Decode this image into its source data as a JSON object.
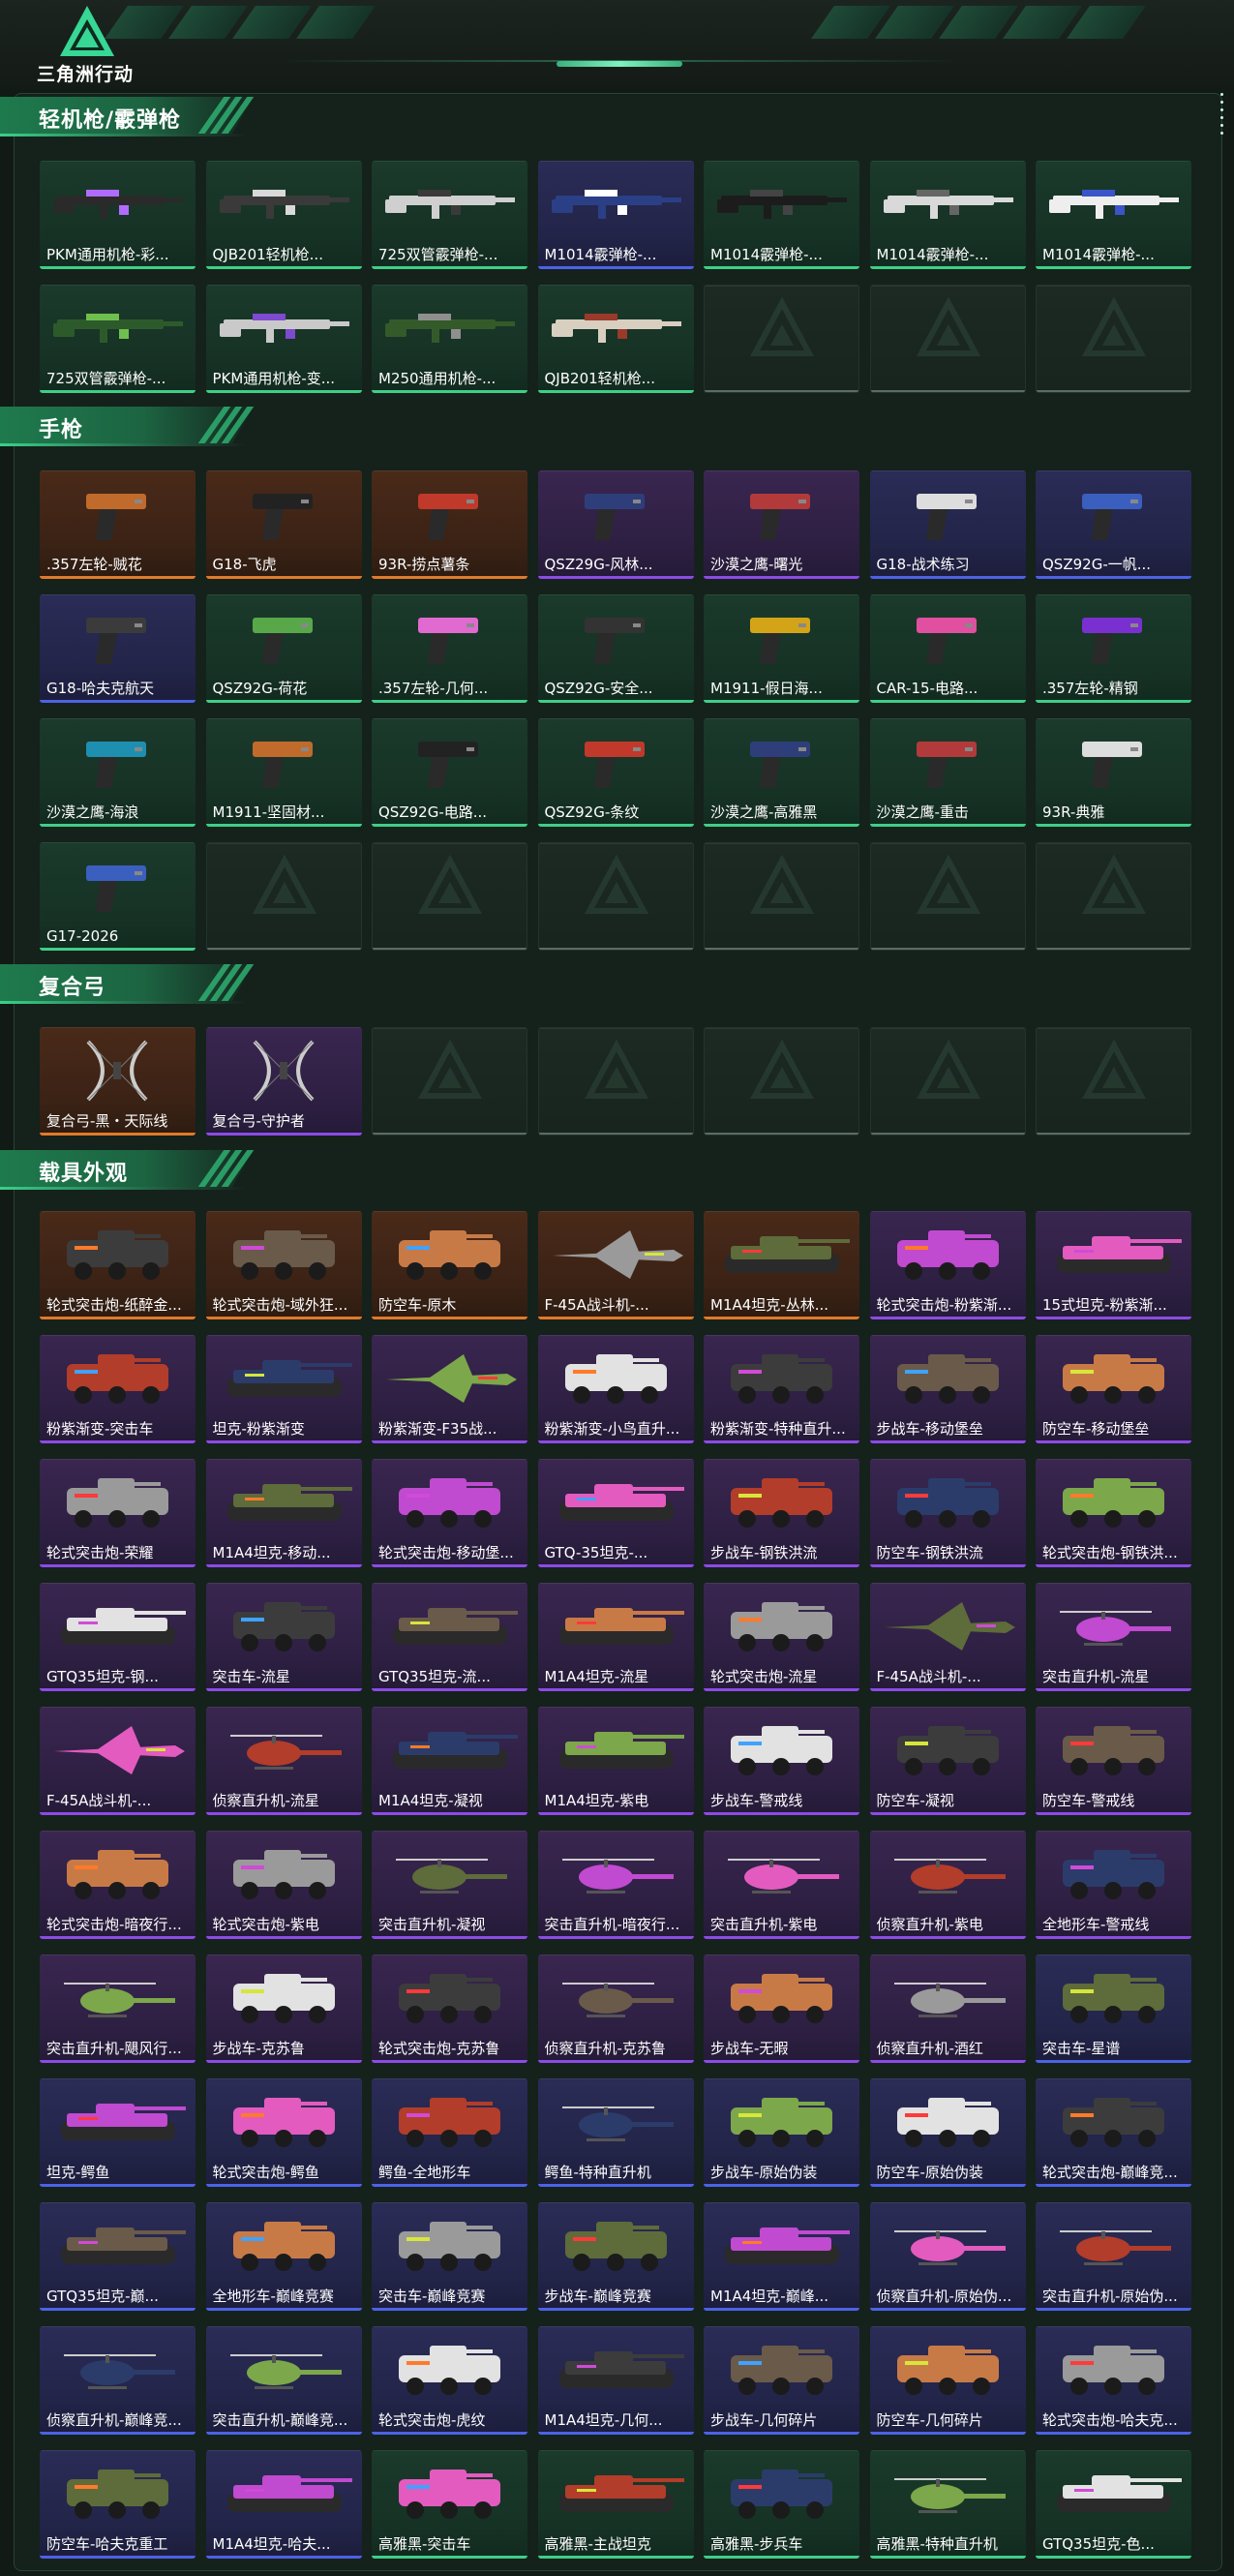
{
  "app": {
    "logo_text": "三角洲行动"
  },
  "sections": [
    {
      "id": "lmg-shotgun",
      "title": "轻机枪/霰弹枪",
      "kind": "gun",
      "items": [
        {
          "label": "PKM通用机枪-彩...",
          "rarity": "green"
        },
        {
          "label": "QJB201轻机枪...",
          "rarity": "green"
        },
        {
          "label": "725双管霰弹枪-...",
          "rarity": "green"
        },
        {
          "label": "M1014霰弹枪-...",
          "rarity": "blue"
        },
        {
          "label": "M1014霰弹枪-...",
          "rarity": "green"
        },
        {
          "label": "M1014霰弹枪-...",
          "rarity": "green"
        },
        {
          "label": "M1014霰弹枪-...",
          "rarity": "green"
        },
        {
          "label": "725双管霰弹枪-...",
          "rarity": "green"
        },
        {
          "label": "PKM通用机枪-变...",
          "rarity": "green"
        },
        {
          "label": "M250通用机枪-...",
          "rarity": "green"
        },
        {
          "label": "QJB201轻机枪...",
          "rarity": "green"
        },
        {
          "label": "",
          "rarity": "empty"
        },
        {
          "label": "",
          "rarity": "empty"
        },
        {
          "label": "",
          "rarity": "empty"
        }
      ]
    },
    {
      "id": "pistol",
      "title": "手枪",
      "kind": "pistol",
      "items": [
        {
          "label": ".357左轮-贼花",
          "rarity": "orange"
        },
        {
          "label": "G18-飞虎",
          "rarity": "orange"
        },
        {
          "label": "93R-捞点薯条",
          "rarity": "orange"
        },
        {
          "label": "QSZ29G-风林...",
          "rarity": "purple"
        },
        {
          "label": "沙漠之鹰-曙光",
          "rarity": "purple"
        },
        {
          "label": "G18-战术练习",
          "rarity": "blue"
        },
        {
          "label": "QSZ92G-一帆...",
          "rarity": "blue"
        },
        {
          "label": "G18-哈夫克航天",
          "rarity": "blue"
        },
        {
          "label": "QSZ92G-荷花",
          "rarity": "green"
        },
        {
          "label": ".357左轮-几何...",
          "rarity": "green"
        },
        {
          "label": "QSZ92G-安全...",
          "rarity": "green"
        },
        {
          "label": "M1911-假日海...",
          "rarity": "green"
        },
        {
          "label": "CAR-15-电路...",
          "rarity": "green"
        },
        {
          "label": ".357左轮-精钢",
          "rarity": "green"
        },
        {
          "label": "沙漠之鹰-海浪",
          "rarity": "green"
        },
        {
          "label": "M1911-坚固材...",
          "rarity": "green"
        },
        {
          "label": "QSZ92G-电路...",
          "rarity": "green"
        },
        {
          "label": "QSZ92G-条纹",
          "rarity": "green"
        },
        {
          "label": "沙漠之鹰-高雅黑",
          "rarity": "green"
        },
        {
          "label": "沙漠之鹰-重击",
          "rarity": "green"
        },
        {
          "label": "93R-典雅",
          "rarity": "green"
        },
        {
          "label": "G17-2026",
          "rarity": "green"
        },
        {
          "label": "",
          "rarity": "empty"
        },
        {
          "label": "",
          "rarity": "empty"
        },
        {
          "label": "",
          "rarity": "empty"
        },
        {
          "label": "",
          "rarity": "empty"
        },
        {
          "label": "",
          "rarity": "empty"
        },
        {
          "label": "",
          "rarity": "empty"
        }
      ]
    },
    {
      "id": "bow",
      "title": "复合弓",
      "kind": "bow",
      "items": [
        {
          "label": "复合弓-黑・天际线",
          "rarity": "orange"
        },
        {
          "label": "复合弓-守护者",
          "rarity": "purple"
        },
        {
          "label": "",
          "rarity": "empty"
        },
        {
          "label": "",
          "rarity": "empty"
        },
        {
          "label": "",
          "rarity": "empty"
        },
        {
          "label": "",
          "rarity": "empty"
        },
        {
          "label": "",
          "rarity": "empty"
        }
      ]
    },
    {
      "id": "vehicle",
      "title": "载具外观",
      "kind": "vehicle",
      "items": [
        {
          "label": "轮式突击炮-纸醉金...",
          "rarity": "orange"
        },
        {
          "label": "轮式突击炮-域外狂...",
          "rarity": "orange"
        },
        {
          "label": "防空车-原木",
          "rarity": "orange"
        },
        {
          "label": "F-45A战斗机-...",
          "rarity": "orange"
        },
        {
          "label": "M1A4坦克-丛林...",
          "rarity": "orange"
        },
        {
          "label": "轮式突击炮-粉紫渐...",
          "rarity": "purple"
        },
        {
          "label": "15式坦克-粉紫渐...",
          "rarity": "purple"
        },
        {
          "label": "粉紫渐变-突击车",
          "rarity": "purple"
        },
        {
          "label": "坦克-粉紫渐变",
          "rarity": "purple"
        },
        {
          "label": "粉紫渐变-F35战...",
          "rarity": "purple"
        },
        {
          "label": "粉紫渐变-小鸟直升...",
          "rarity": "purple"
        },
        {
          "label": "粉紫渐变-特种直升...",
          "rarity": "purple"
        },
        {
          "label": "步战车-移动堡垒",
          "rarity": "purple"
        },
        {
          "label": "防空车-移动堡垒",
          "rarity": "purple"
        },
        {
          "label": "轮式突击炮-荣耀",
          "rarity": "purple"
        },
        {
          "label": "M1A4坦克-移动...",
          "rarity": "purple"
        },
        {
          "label": "轮式突击炮-移动堡...",
          "rarity": "purple"
        },
        {
          "label": "GTQ-35坦克-...",
          "rarity": "purple"
        },
        {
          "label": "步战车-钢铁洪流",
          "rarity": "purple"
        },
        {
          "label": "防空车-钢铁洪流",
          "rarity": "purple"
        },
        {
          "label": "轮式突击炮-钢铁洪...",
          "rarity": "purple"
        },
        {
          "label": "GTQ35坦克-钢...",
          "rarity": "purple"
        },
        {
          "label": "突击车-流星",
          "rarity": "purple"
        },
        {
          "label": "GTQ35坦克-流...",
          "rarity": "purple"
        },
        {
          "label": "M1A4坦克-流星",
          "rarity": "purple"
        },
        {
          "label": "轮式突击炮-流星",
          "rarity": "purple"
        },
        {
          "label": "F-45A战斗机-...",
          "rarity": "purple"
        },
        {
          "label": "突击直升机-流星",
          "rarity": "purple"
        },
        {
          "label": "F-45A战斗机-...",
          "rarity": "purple"
        },
        {
          "label": "侦察直升机-流星",
          "rarity": "purple"
        },
        {
          "label": "M1A4坦克-凝视",
          "rarity": "purple"
        },
        {
          "label": "M1A4坦克-紫电",
          "rarity": "purple"
        },
        {
          "label": "步战车-警戒线",
          "rarity": "purple"
        },
        {
          "label": "防空车-凝视",
          "rarity": "purple"
        },
        {
          "label": "防空车-警戒线",
          "rarity": "purple"
        },
        {
          "label": "轮式突击炮-暗夜行...",
          "rarity": "purple"
        },
        {
          "label": "轮式突击炮-紫电",
          "rarity": "purple"
        },
        {
          "label": "突击直升机-凝视",
          "rarity": "purple"
        },
        {
          "label": "突击直升机-暗夜行...",
          "rarity": "purple"
        },
        {
          "label": "突击直升机-紫电",
          "rarity": "purple"
        },
        {
          "label": "侦察直升机-紫电",
          "rarity": "purple"
        },
        {
          "label": "全地形车-警戒线",
          "rarity": "purple"
        },
        {
          "label": "突击直升机-飓风行...",
          "rarity": "purple"
        },
        {
          "label": "步战车-克苏鲁",
          "rarity": "purple"
        },
        {
          "label": "轮式突击炮-克苏鲁",
          "rarity": "purple"
        },
        {
          "label": "侦察直升机-克苏鲁",
          "rarity": "purple"
        },
        {
          "label": "步战车-无暇",
          "rarity": "purple"
        },
        {
          "label": "侦察直升机-酒红",
          "rarity": "purple"
        },
        {
          "label": "突击车-星谱",
          "rarity": "blue"
        },
        {
          "label": "坦克-鳄鱼",
          "rarity": "blue"
        },
        {
          "label": "轮式突击炮-鳄鱼",
          "rarity": "blue"
        },
        {
          "label": "鳄鱼-全地形车",
          "rarity": "blue"
        },
        {
          "label": "鳄鱼-特种直升机",
          "rarity": "blue"
        },
        {
          "label": "步战车-原始伪装",
          "rarity": "blue"
        },
        {
          "label": "防空车-原始伪装",
          "rarity": "blue"
        },
        {
          "label": "轮式突击炮-巅峰竞...",
          "rarity": "blue"
        },
        {
          "label": "GTQ35坦克-巅...",
          "rarity": "blue"
        },
        {
          "label": "全地形车-巅峰竞赛",
          "rarity": "blue"
        },
        {
          "label": "突击车-巅峰竞赛",
          "rarity": "blue"
        },
        {
          "label": "步战车-巅峰竞赛",
          "rarity": "blue"
        },
        {
          "label": "M1A4坦克-巅峰...",
          "rarity": "blue"
        },
        {
          "label": "侦察直升机-原始伪...",
          "rarity": "blue"
        },
        {
          "label": "突击直升机-原始伪...",
          "rarity": "blue"
        },
        {
          "label": "侦察直升机-巅峰竞...",
          "rarity": "blue"
        },
        {
          "label": "突击直升机-巅峰竞...",
          "rarity": "blue"
        },
        {
          "label": "轮式突击炮-虎纹",
          "rarity": "blue"
        },
        {
          "label": "M1A4坦克-几何...",
          "rarity": "blue"
        },
        {
          "label": "步战车-几何碎片",
          "rarity": "blue"
        },
        {
          "label": "防空车-几何碎片",
          "rarity": "blue"
        },
        {
          "label": "轮式突击炮-哈夫克...",
          "rarity": "blue"
        },
        {
          "label": "防空车-哈夫克重工",
          "rarity": "blue"
        },
        {
          "label": "M1A4坦克-哈夫...",
          "rarity": "blue"
        },
        {
          "label": "高雅黑-突击车",
          "rarity": "green"
        },
        {
          "label": "高雅黑-主战坦克",
          "rarity": "green"
        },
        {
          "label": "高雅黑-步兵车",
          "rarity": "green"
        },
        {
          "label": "高雅黑-特种直升机",
          "rarity": "green"
        },
        {
          "label": "GTQ35坦克-色...",
          "rarity": "green"
        }
      ]
    }
  ]
}
